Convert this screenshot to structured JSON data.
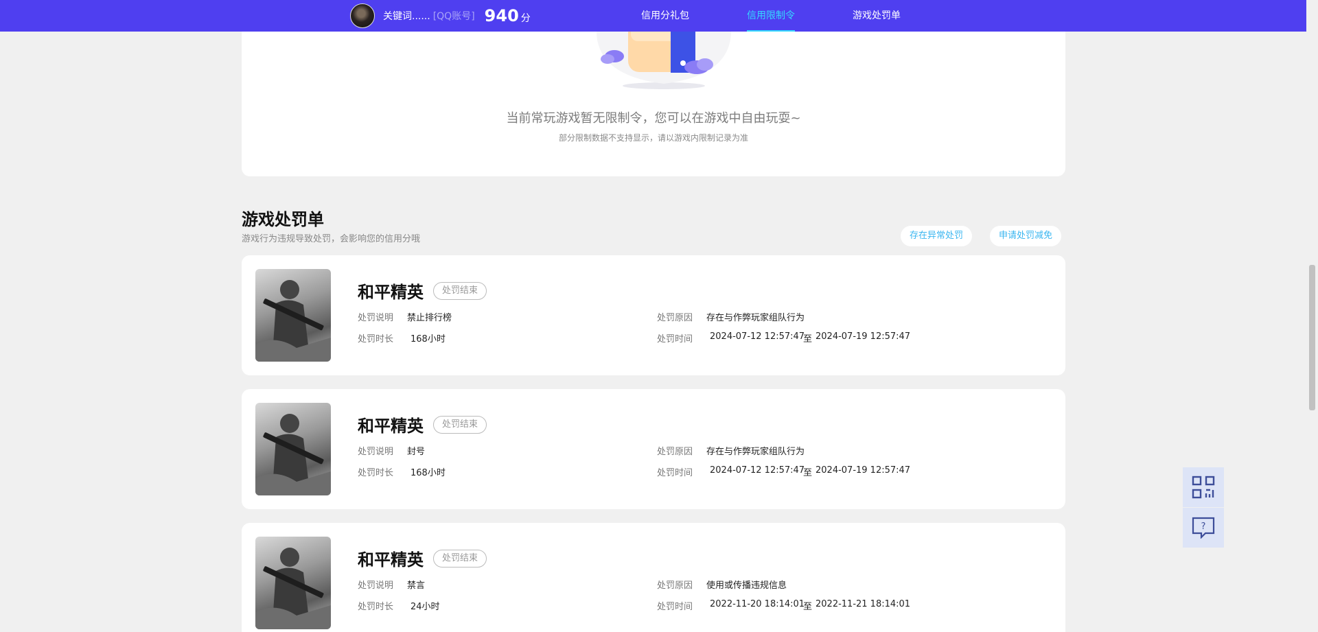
{
  "header": {
    "user_name": "关键词......",
    "account_type": "[QQ账号]",
    "score": "940",
    "score_unit": "分",
    "nav": [
      {
        "label": "信用分礼包",
        "active": false
      },
      {
        "label": "信用限制令",
        "active": true
      },
      {
        "label": "游戏处罚单",
        "active": false
      }
    ]
  },
  "restriction": {
    "message": "当前常玩游戏暂无限制令，您可以在游戏中自由玩耍~",
    "note": "部分限制数据不支持显示，请以游戏内限制记录为准"
  },
  "penalties": {
    "title": "游戏处罚单",
    "subtitle": "游戏行为违规导致处罚，会影响您的信用分哦",
    "abnormal_button": "存在异常处罚",
    "appeal_button": "申请处罚减免",
    "labels": {
      "description": "处罚说明",
      "reason": "处罚原因",
      "duration": "处罚时长",
      "time": "处罚时间",
      "to": "至"
    },
    "items": [
      {
        "game": "和平精英",
        "status": "处罚结束",
        "description": "禁止排行榜",
        "reason": "存在与作弊玩家组队行为",
        "duration": "168小时",
        "start": "2024-07-12 12:57:47",
        "end": "2024-07-19 12:57:47"
      },
      {
        "game": "和平精英",
        "status": "处罚结束",
        "description": "封号",
        "reason": "存在与作弊玩家组队行为",
        "duration": "168小时",
        "start": "2024-07-12 12:57:47",
        "end": "2024-07-19 12:57:47"
      },
      {
        "game": "和平精英",
        "status": "处罚结束",
        "description": "禁言",
        "reason": "使用或传播违规信息",
        "duration": "24小时",
        "start": "2022-11-20 18:14:01",
        "end": "2022-11-21 18:14:01"
      }
    ]
  },
  "side_tools": [
    {
      "icon": "qr-code-icon"
    },
    {
      "icon": "help-chat-icon"
    }
  ]
}
